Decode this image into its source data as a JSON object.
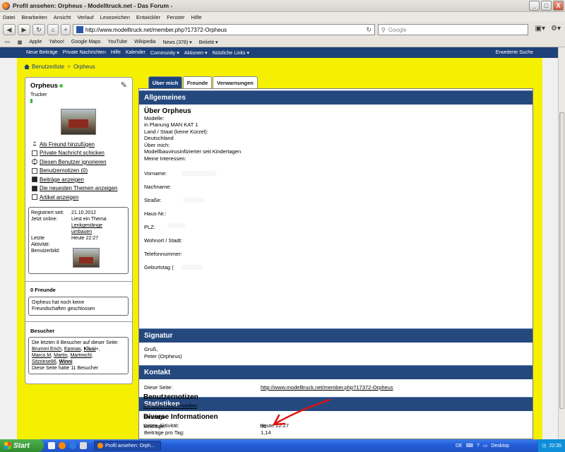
{
  "window": {
    "title": "Profil ansehen: Orpheus - Modelltruck.net - Das Forum -",
    "buttons": {
      "minimize": "_",
      "maximize": "□",
      "close": "X"
    }
  },
  "menubar": [
    "Datei",
    "Bearbeiten",
    "Ansicht",
    "Verlauf",
    "Lesezeichen",
    "Entwickler",
    "Fenster",
    "Hilfe"
  ],
  "navbar": {
    "url": "http://www.modelltruck.net/member.php?17372-Orpheus",
    "search_placeholder": "Google"
  },
  "bookmarks": [
    "Apple",
    "Yahoo!",
    "Google Maps",
    "YouTube",
    "Wikipedia",
    "News (378) ▾",
    "Beliebt ▾"
  ],
  "forum_nav": {
    "items": [
      "Neue Beiträge",
      "Private Nachrichten",
      "Hilfe",
      "Kalender",
      "Community ▾",
      "Aktionen ▾",
      "Nützliche Links ▾"
    ],
    "right": "Erweiterte Suche"
  },
  "breadcrumb": {
    "list": "Benutzerliste",
    "current": "Orpheus"
  },
  "sidebar": {
    "username": "Orpheus",
    "rank": "Trucker",
    "links": [
      "Als Freund hinzufügen",
      "Private Nachricht schicken",
      "Diesen Benutzer ignorieren",
      "Benutzernotizen (0)",
      "Beiträge anzeigen",
      "Die neuesten Themen anzeigen",
      "Artikel anzeigen"
    ],
    "info": {
      "registered_label": "Registriert seit:",
      "registered_value": "21.10.2012",
      "online_label": "Jetzt online:",
      "online_value_1": "Liest ein Thema",
      "online_value_2": "Lenkgestänge",
      "online_value_3": "umbauen",
      "last_label_1": "Letzte",
      "last_label_2": "Aktivität:",
      "last_value": "Heute 22:27",
      "avatar_label": "Benutzerbild:"
    },
    "friends": {
      "title": "0 Freunde",
      "text_1": "Orpheus hat noch keine",
      "text_2": "Freundschaften geschlossen"
    },
    "visitors": {
      "title": "Besucher",
      "intro": "Die letzten 8 Besucher auf dieser Seite:",
      "names_line_1": [
        "Brummi Erich",
        "Eponas",
        "Klusi"
      ],
      "names_line_2": [
        "Marco.M",
        "Martin",
        "Martmichl"
      ],
      "names_line_3": [
        "Sitzriese86",
        "Winni"
      ],
      "klusi_suffix": "+,",
      "footer": "Diese Seite hatte 11 Besucher"
    }
  },
  "tabs": [
    "Über mich",
    "Freunde",
    "Verwarnungen"
  ],
  "main": {
    "allgemeines": {
      "header": "Allgemeines",
      "title": "Über Orpheus",
      "lines": [
        "Modelle:",
        "in Planung MAN KAT 1",
        "Land / Staat (keine Kürzel):",
        "Deutschland",
        "Über mich:",
        "Modellbauvirusinfizierter seit Kindertagen",
        "Meine Interessen:"
      ],
      "fields": [
        "Vorname:",
        "Nachname:",
        "Straße:",
        "Haus-Nr.:",
        "PLZ:",
        "Wohnort / Stadt:",
        "Telefonnummer:",
        "Geburtstag ("
      ]
    },
    "signatur": {
      "header": "Signatur",
      "lines": [
        "Gruß,",
        "Peter (Orpheus)"
      ]
    },
    "kontakt": {
      "header": "Kontakt",
      "label": "Diese Seite:",
      "value": "http://www.modelltruck.net/member.php?17372-Orpheus"
    },
    "statistiken": {
      "header": "Statistiken",
      "beitraege_title": "Beiträge",
      "beitraege_label": "Beiträge:",
      "beitraege_value": "30",
      "pro_tag_label": "Beiträge pro Tag:",
      "pro_tag_value": "1,14",
      "notizen_title": "Benutzernotizen",
      "notizen_link": "Benutzernotiz erstellen",
      "diverse_title": "Diverse Informationen",
      "letzte_label": "Letzte Aktivität:",
      "letzte_value": "Heute 22:27"
    }
  },
  "taskbar": {
    "start": "Start",
    "task": "Profil ansehen: Orph...",
    "lang": "DE",
    "desktop": "Desktop",
    "time": "22:35"
  },
  "colors": {
    "forum_blue": "#1d4178",
    "frame_yellow": "#f5f000",
    "arrow_red": "#e01010"
  }
}
